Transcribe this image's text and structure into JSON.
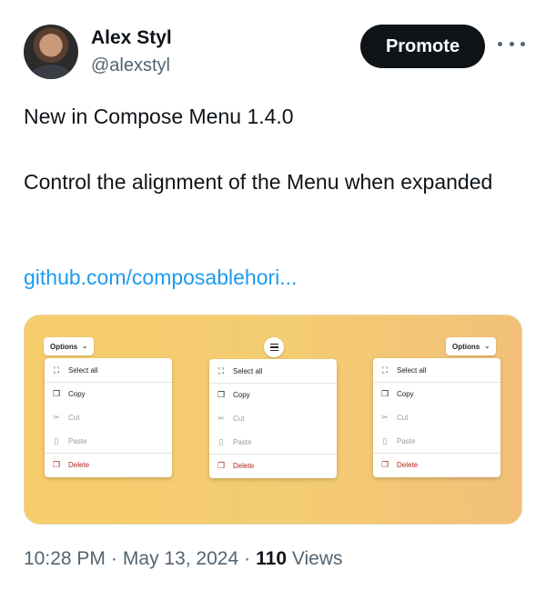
{
  "author": {
    "name": "Alex Styl",
    "handle": "@alexstyl"
  },
  "actions": {
    "promote_label": "Promote",
    "more_icon": "more-horizontal-icon"
  },
  "tweet": {
    "line1": "New in Compose Menu 1.4.0",
    "line2": "Control the alignment of the Menu when expanded",
    "link_text": "github.com/composablehori..."
  },
  "media": {
    "background_color": "#f5c96f",
    "trigger_label": "Options",
    "menu_items": [
      {
        "label": "Select all",
        "icon": "select-all-icon",
        "state": "normal"
      },
      {
        "label": "Copy",
        "icon": "copy-icon",
        "state": "normal"
      },
      {
        "label": "Cut",
        "icon": "scissors-icon",
        "state": "disabled"
      },
      {
        "label": "Paste",
        "icon": "clipboard-icon",
        "state": "disabled"
      },
      {
        "label": "Delete",
        "icon": "delete-icon",
        "state": "danger"
      }
    ]
  },
  "meta": {
    "time": "10:28 PM",
    "sep1": "·",
    "date": "May 13, 2024",
    "sep2": "·",
    "views_count": "110",
    "views_label": "Views"
  }
}
